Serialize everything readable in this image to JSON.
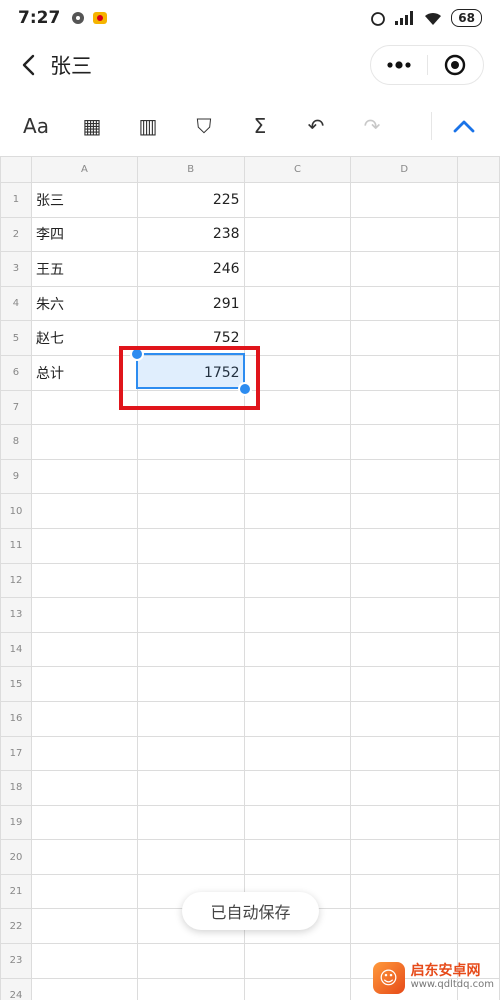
{
  "status": {
    "time": "7:27",
    "battery": "68"
  },
  "nav": {
    "title": "张三",
    "back_icon": "chevron-left-icon",
    "more_icon": "more-dots-icon",
    "close_icon": "target-icon"
  },
  "toolbar": [
    {
      "name": "text-format-icon",
      "glyph": "Aa",
      "disabled": false
    },
    {
      "name": "cell-border-icon",
      "glyph": "▦",
      "disabled": false
    },
    {
      "name": "freeze-panes-icon",
      "glyph": "▥",
      "disabled": false
    },
    {
      "name": "filter-icon",
      "glyph": "⛉",
      "disabled": false
    },
    {
      "name": "sum-icon",
      "glyph": "Σ",
      "disabled": false
    },
    {
      "name": "undo-icon",
      "glyph": "↶",
      "disabled": false
    },
    {
      "name": "redo-icon",
      "glyph": "↷",
      "disabled": true
    }
  ],
  "sheet": {
    "columns": [
      "A",
      "B",
      "C",
      "D"
    ],
    "rows": [
      {
        "n": "1",
        "a": "张三",
        "b": "225"
      },
      {
        "n": "2",
        "a": "李四",
        "b": "238"
      },
      {
        "n": "3",
        "a": "王五",
        "b": "246"
      },
      {
        "n": "4",
        "a": "朱六",
        "b": "291"
      },
      {
        "n": "5",
        "a": "赵七",
        "b": "752"
      },
      {
        "n": "6",
        "a": "总计",
        "b": "1752"
      },
      {
        "n": "7",
        "a": "",
        "b": ""
      },
      {
        "n": "8",
        "a": "",
        "b": ""
      },
      {
        "n": "9",
        "a": "",
        "b": ""
      },
      {
        "n": "10",
        "a": "",
        "b": ""
      },
      {
        "n": "11",
        "a": "",
        "b": ""
      },
      {
        "n": "12",
        "a": "",
        "b": ""
      },
      {
        "n": "13",
        "a": "",
        "b": ""
      },
      {
        "n": "14",
        "a": "",
        "b": ""
      },
      {
        "n": "15",
        "a": "",
        "b": ""
      },
      {
        "n": "16",
        "a": "",
        "b": ""
      },
      {
        "n": "17",
        "a": "",
        "b": ""
      },
      {
        "n": "18",
        "a": "",
        "b": ""
      },
      {
        "n": "19",
        "a": "",
        "b": ""
      },
      {
        "n": "20",
        "a": "",
        "b": ""
      },
      {
        "n": "21",
        "a": "",
        "b": ""
      },
      {
        "n": "22",
        "a": "",
        "b": ""
      },
      {
        "n": "23",
        "a": "",
        "b": ""
      },
      {
        "n": "24",
        "a": "",
        "b": ""
      }
    ],
    "selected_cell": "B6"
  },
  "toast": "已自动保存",
  "watermark": {
    "name": "启东安卓网",
    "url": "www.qdltdq.com"
  },
  "colors": {
    "accent": "#2d8cf0",
    "highlight": "#e0151b"
  }
}
